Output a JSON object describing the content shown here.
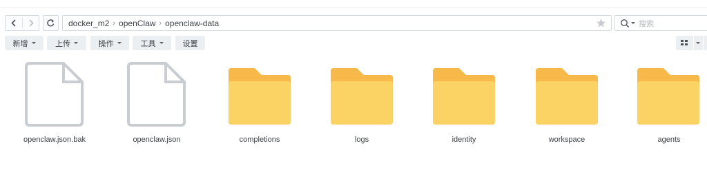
{
  "path": {
    "segments": [
      "docker_m2",
      "openClaw",
      "openclaw-data"
    ]
  },
  "search": {
    "placeholder": "搜索"
  },
  "toolbar": {
    "new_label": "新增",
    "upload_label": "上传",
    "action_label": "操作",
    "tools_label": "工具",
    "settings_label": "设置"
  },
  "icons": {
    "back": "chevron-left-icon",
    "forward": "chevron-right-icon",
    "refresh": "refresh-icon",
    "star": "star-icon",
    "search": "search-icon",
    "view": "grid-view-icon",
    "file": "file-icon",
    "folder": "folder-icon"
  },
  "colors": {
    "folder_front": "#fbd264",
    "folder_back": "#f6b94a",
    "file_stroke": "#c9cdd2"
  },
  "items": [
    {
      "name": "openclaw.json.bak",
      "type": "file"
    },
    {
      "name": "openclaw.json",
      "type": "file"
    },
    {
      "name": "completions",
      "type": "folder"
    },
    {
      "name": "logs",
      "type": "folder"
    },
    {
      "name": "identity",
      "type": "folder"
    },
    {
      "name": "workspace",
      "type": "folder"
    },
    {
      "name": "agents",
      "type": "folder"
    }
  ]
}
